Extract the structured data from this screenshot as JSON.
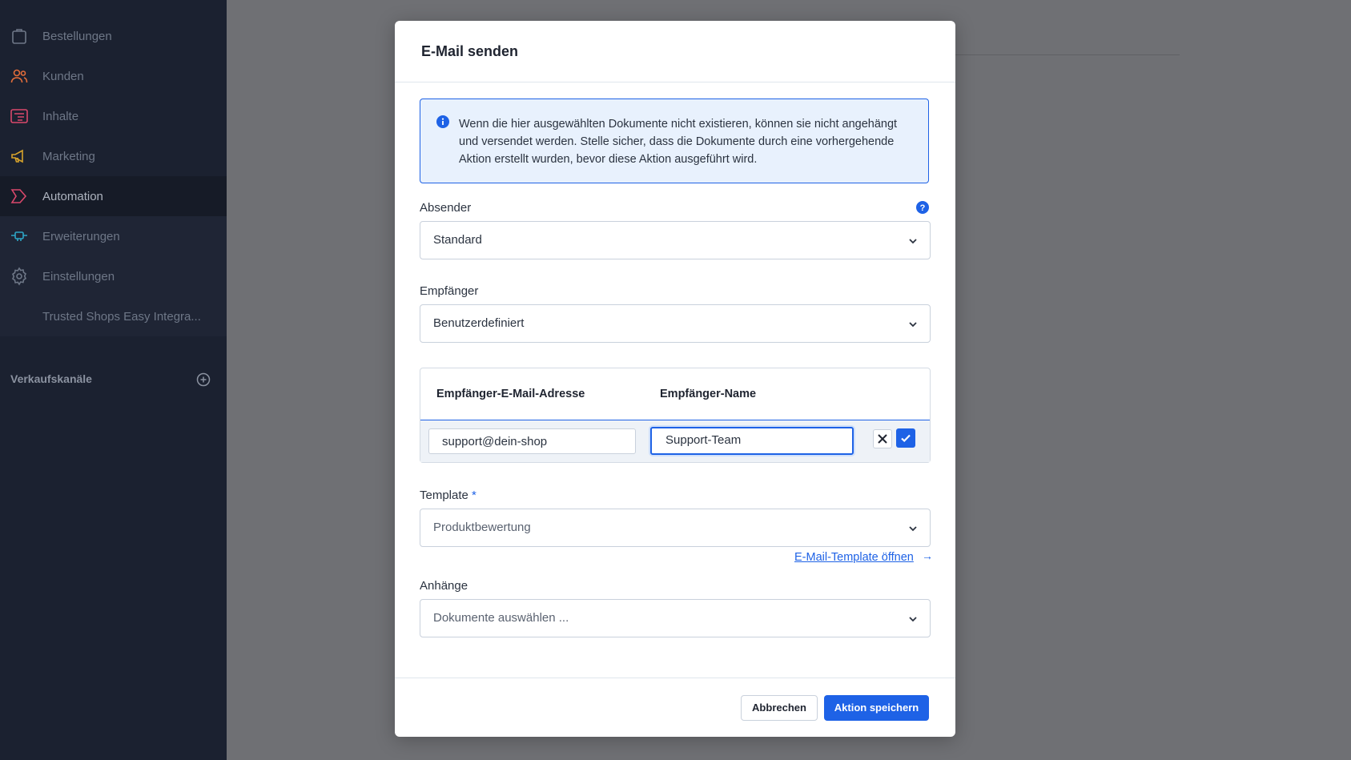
{
  "sidebar": {
    "items": [
      {
        "label": "Bestellungen",
        "icon": "shopping-bag-icon",
        "color": "#6e7787"
      },
      {
        "label": "Kunden",
        "icon": "users-icon",
        "color": "#e36d3a"
      },
      {
        "label": "Inhalte",
        "icon": "content-icon",
        "color": "#d9486b"
      },
      {
        "label": "Marketing",
        "icon": "megaphone-icon",
        "color": "#d7a32b"
      },
      {
        "label": "Automation",
        "icon": "automation-icon",
        "color": "#d9486b"
      },
      {
        "label": "Erweiterungen",
        "icon": "plug-icon",
        "color": "#2ea7c7"
      },
      {
        "label": "Einstellungen",
        "icon": "gear-icon",
        "color": "#6e7787"
      },
      {
        "label": "Trusted Shops Easy Integra..."
      }
    ],
    "channels_label": "Verkaufskanäle"
  },
  "modal": {
    "title": "E-Mail senden",
    "info_text": "Wenn die hier ausgewählten Dokumente nicht existieren, können sie nicht angehängt und versendet werden. Stelle sicher, dass die Dokumente durch eine vorhergehende Aktion erstellt wurden, bevor diese Aktion ausgeführt wird.",
    "sender": {
      "label": "Absender",
      "value": "Standard"
    },
    "recipient": {
      "label": "Empfänger",
      "value": "Benutzerdefiniert"
    },
    "grid": {
      "col_email": "Empfänger-E-Mail-Adresse",
      "col_name": "Empfänger-Name",
      "row_email": "support@dein-shop",
      "row_name": "Support-Team"
    },
    "template": {
      "label": "Template",
      "required_mark": "*",
      "value": "Produktbewertung"
    },
    "template_link": "E-Mail-Template öffnen",
    "template_link_arrow": "→",
    "attachments": {
      "label": "Anhänge",
      "placeholder": "Dokumente auswählen ..."
    },
    "cancel_label": "Abbrechen",
    "save_label": "Aktion speichern"
  },
  "colors": {
    "accent": "#1e62e6",
    "sidebar_bg": "#1b2130",
    "overlay": "#6f7074"
  }
}
